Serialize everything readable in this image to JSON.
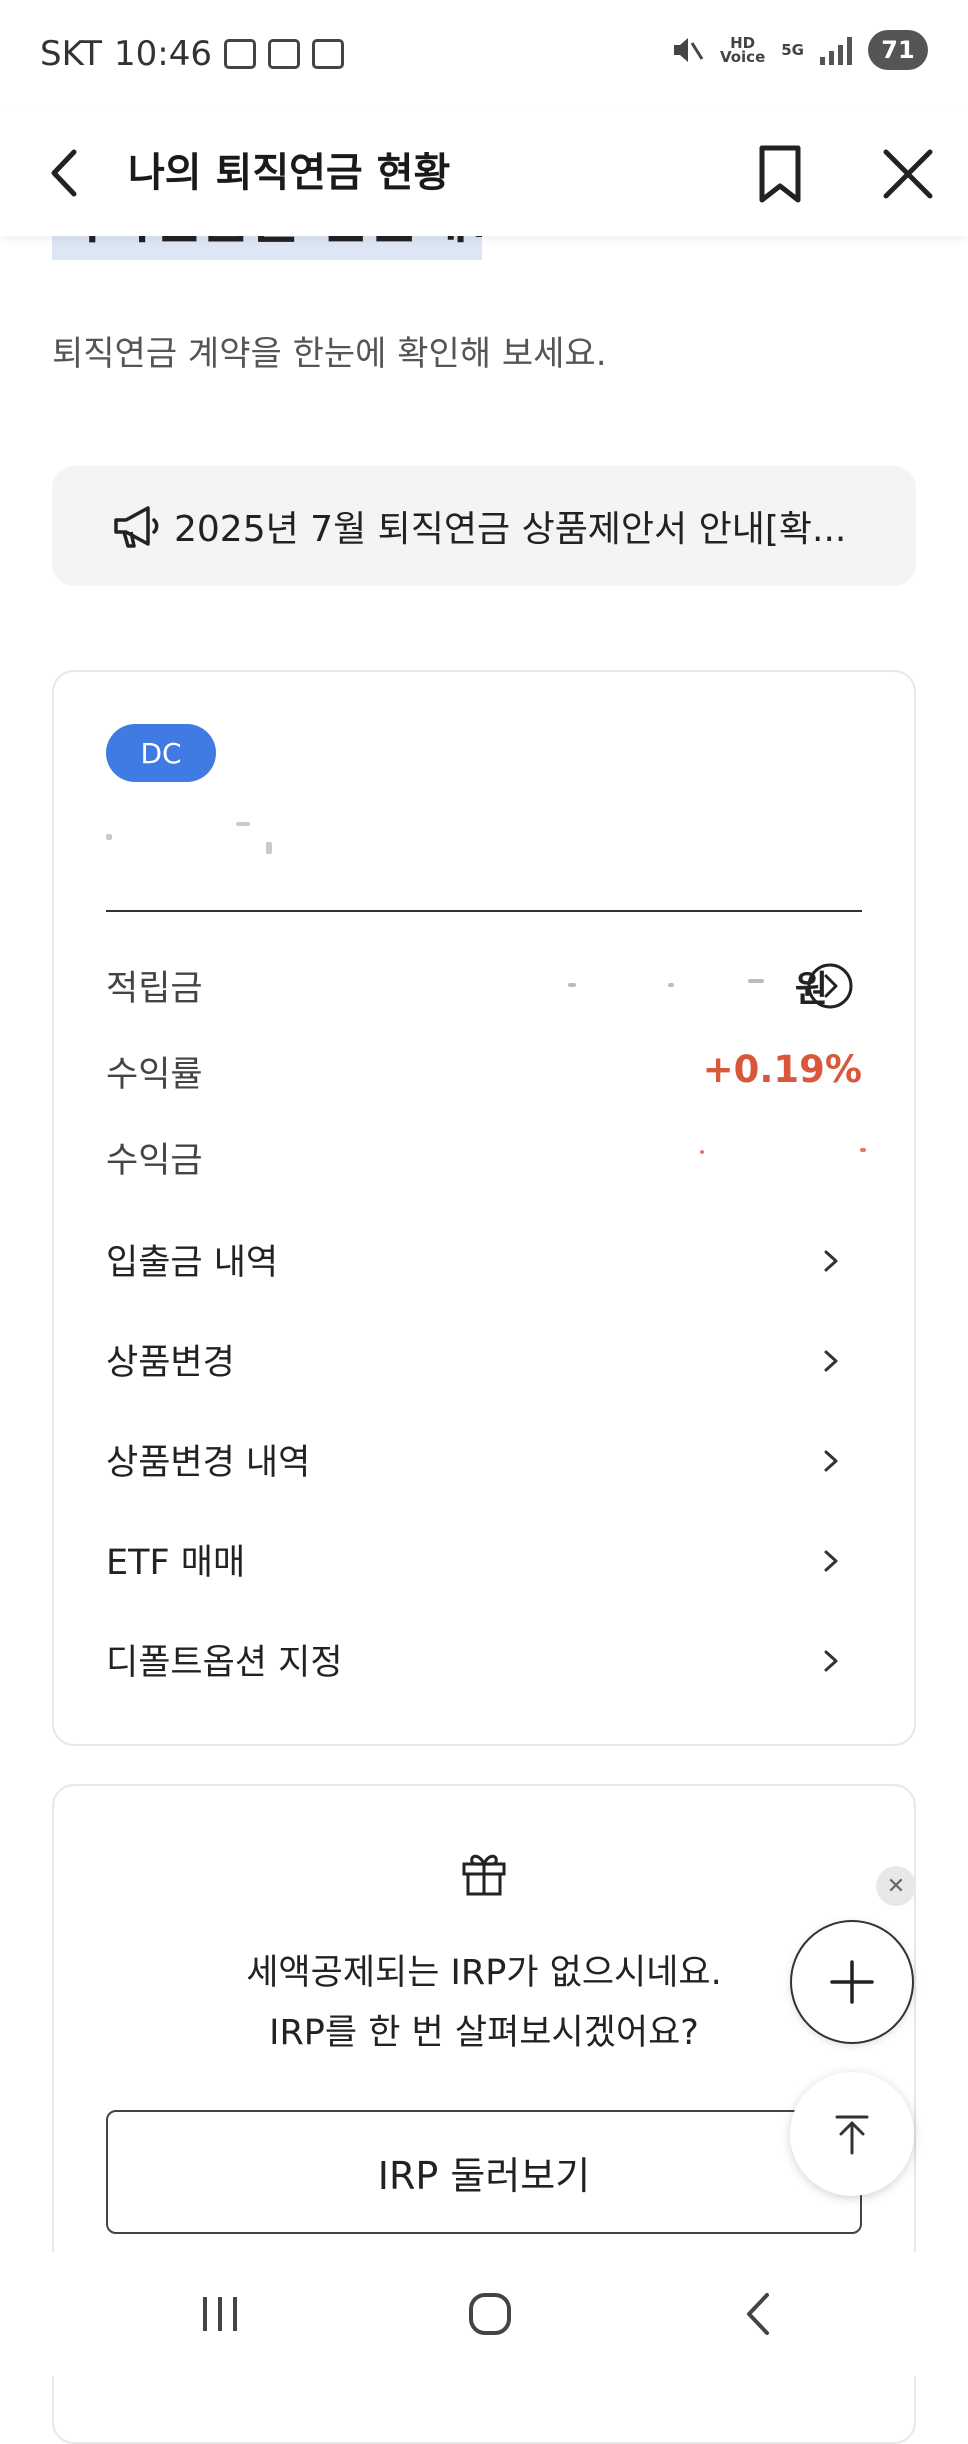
{
  "status_bar": {
    "carrier": "SKT",
    "time": "10:46",
    "hd_voice_label": "HD\nVoice",
    "network": "5G",
    "battery": "71"
  },
  "header": {
    "title": "나의 퇴직연금 현황"
  },
  "intro": {
    "heading_partial": "퇴직연금을 한눈에!",
    "subtitle": "퇴직연금 계약을 한눈에 확인해 보세요."
  },
  "notice": {
    "text": "2025년 7월 퇴직연금 상품제안서 안내[확..."
  },
  "account_card": {
    "badge": "DC",
    "rows": [
      {
        "label": "적립금",
        "value_unit": "원"
      },
      {
        "label": "수익률",
        "value": "+0.19%"
      },
      {
        "label": "수익금"
      }
    ],
    "menu": [
      {
        "label": "입출금 내역"
      },
      {
        "label": "상품변경"
      },
      {
        "label": "상품변경 내역"
      },
      {
        "label": "ETF 매매"
      },
      {
        "label": "디폴트옵션 지정"
      }
    ]
  },
  "irp_card": {
    "line1": "세액공제되는 IRP가 없으시네요.",
    "line2": "IRP를 한 번 살펴보시겠어요?",
    "button_label": "IRP 둘러보기"
  },
  "colors": {
    "badge_blue": "#3f7be3",
    "rate_red": "#d9573b"
  }
}
